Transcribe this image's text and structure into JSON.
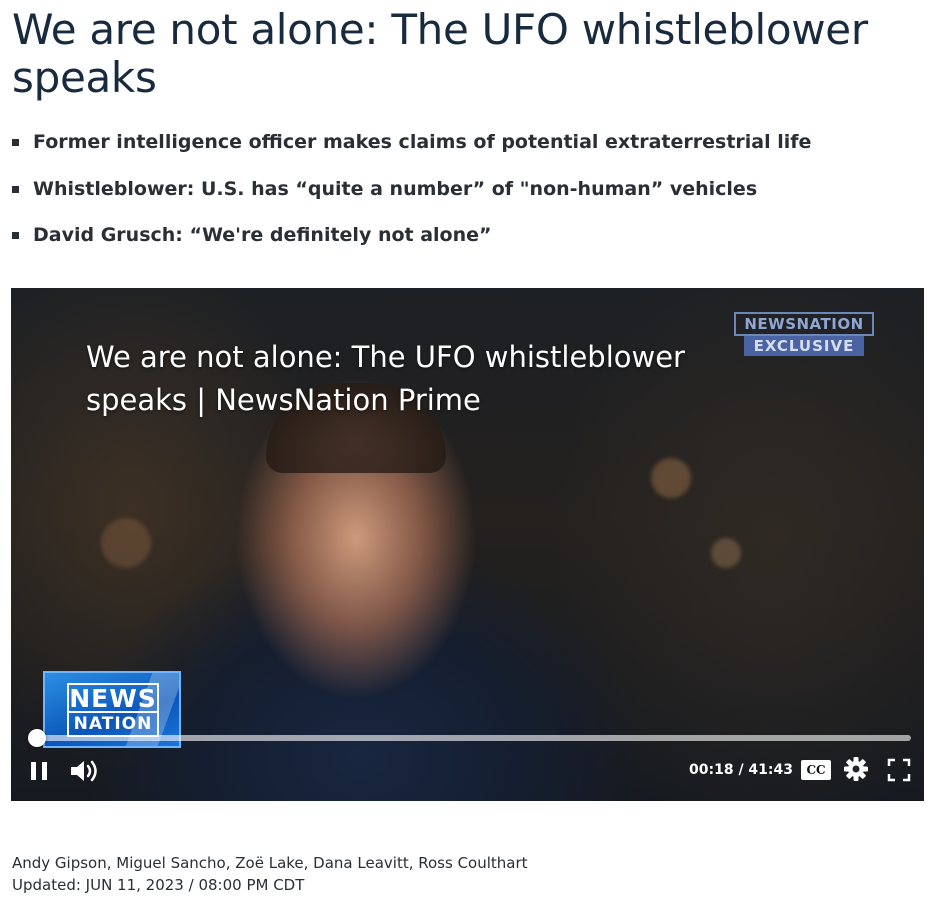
{
  "article": {
    "headline": "We are not alone: The UFO whistleblower speaks",
    "bullets": [
      "Former intelligence officer makes claims of potential extraterrestrial life",
      "Whistleblower: U.S. has “quite a number” of \"non-human” vehicles",
      "David Grusch: “We're definitely not alone”"
    ],
    "authors": "Andy Gipson, Miguel Sancho, Zoë Lake, Dana Leavitt, Ross Coulthart",
    "updated": "Updated: JUN 11, 2023 / 08:00 PM CDT"
  },
  "video": {
    "title": "We are not alone: The UFO whistleblower speaks | NewsNation Prime",
    "badge_top": "NEWSNATION",
    "badge_bottom": "EXCLUSIVE",
    "logo_line1": "NEWS",
    "logo_line2": "NATION",
    "current_time": "00:18",
    "duration": "41:43",
    "time_display": "00:18 / 41:43",
    "progress_fraction": 0.0072,
    "cc_label": "CC",
    "icons": {
      "pause": "pause-icon",
      "volume": "volume-icon",
      "settings": "gear-icon",
      "fullscreen": "fullscreen-icon"
    }
  }
}
